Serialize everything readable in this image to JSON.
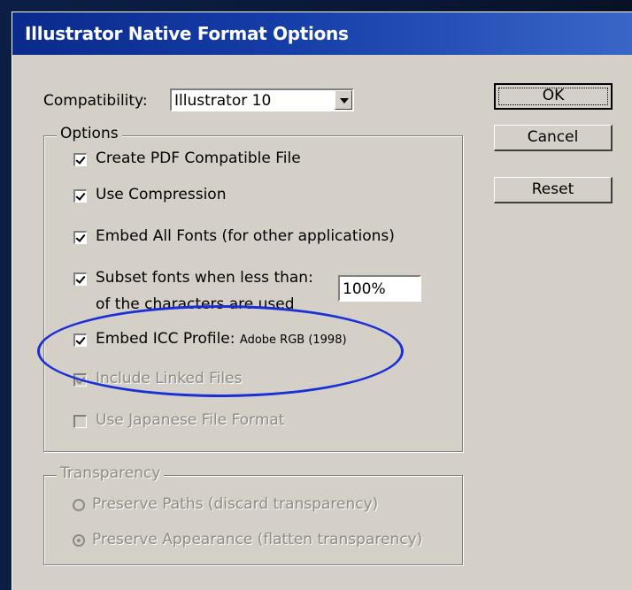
{
  "dialog": {
    "title": "Illustrator Native Format Options",
    "compatibility_label": "Compatibility:",
    "compatibility_value": "Illustrator 10"
  },
  "buttons": {
    "ok": "OK",
    "cancel": "Cancel",
    "reset": "Reset"
  },
  "options_group": {
    "legend": "Options",
    "create_pdf": {
      "label": "Create PDF Compatible File",
      "checked": true,
      "enabled": true
    },
    "use_compression": {
      "label": "Use Compression",
      "checked": true,
      "enabled": true
    },
    "embed_fonts": {
      "label": "Embed All Fonts (for other applications)",
      "checked": true,
      "enabled": true
    },
    "subset_fonts": {
      "label": "Subset fonts when less than:",
      "value": "100%",
      "suffix": "of the characters are used",
      "checked": true,
      "enabled": true
    },
    "embed_icc": {
      "label": "Embed ICC Profile:",
      "profile": "Adobe RGB (1998)",
      "checked": true,
      "enabled": true
    },
    "include_linked": {
      "label": "Include Linked Files",
      "checked": true,
      "enabled": false
    },
    "japanese_format": {
      "label": "Use Japanese File Format",
      "checked": false,
      "enabled": false
    }
  },
  "transparency_group": {
    "legend": "Transparency",
    "preserve_paths": {
      "label": "Preserve Paths (discard transparency)",
      "selected": false,
      "enabled": false
    },
    "preserve_appearance": {
      "label": "Preserve Appearance (flatten transparency)",
      "selected": true,
      "enabled": false
    }
  },
  "annotation": {
    "color": "#1a2fd6"
  }
}
